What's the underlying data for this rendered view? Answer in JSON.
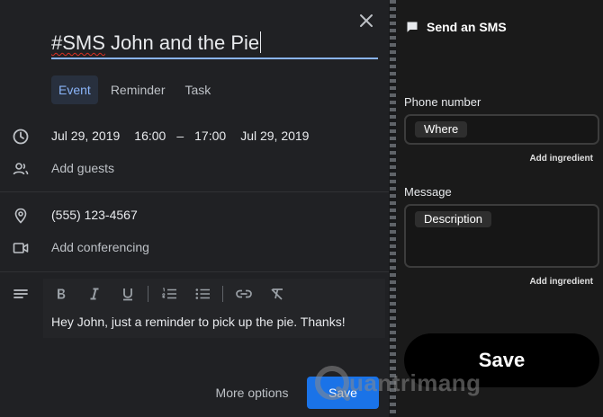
{
  "event": {
    "title_tag": "#SMS",
    "title_rest": " John and the Pie",
    "tabs": [
      {
        "label": "Event",
        "active": true
      },
      {
        "label": "Reminder",
        "active": false
      },
      {
        "label": "Task",
        "active": false
      }
    ],
    "start_date": "Jul 29, 2019",
    "start_time": "16:00",
    "dash": "–",
    "end_time": "17:00",
    "end_date": "Jul 29, 2019",
    "guests_placeholder": "Add guests",
    "location": "(555) 123-4567",
    "conferencing": "Add conferencing",
    "description": "Hey John, just a reminder to pick up the pie. Thanks!",
    "more_options": "More options",
    "save": "Save"
  },
  "action": {
    "title": "Send an SMS",
    "phone_label": "Phone number",
    "phone_chip": "Where",
    "message_label": "Message",
    "message_chip": "Description",
    "add_ingredient": "Add ingredient",
    "save": "Save"
  },
  "watermark": {
    "text": "uantrimang"
  },
  "colors": {
    "accent": "#8ab4f8",
    "save_button": "#1a73e8",
    "background": "#202124",
    "panel": "#1a1a1a"
  },
  "icons": [
    "close-icon",
    "clock-icon",
    "people-icon",
    "location-icon",
    "video-icon",
    "notes-icon",
    "bold-icon",
    "italic-icon",
    "underline-icon",
    "numbered-list-icon",
    "bulleted-list-icon",
    "link-icon",
    "clear-format-icon",
    "sms-bubble-icon"
  ]
}
